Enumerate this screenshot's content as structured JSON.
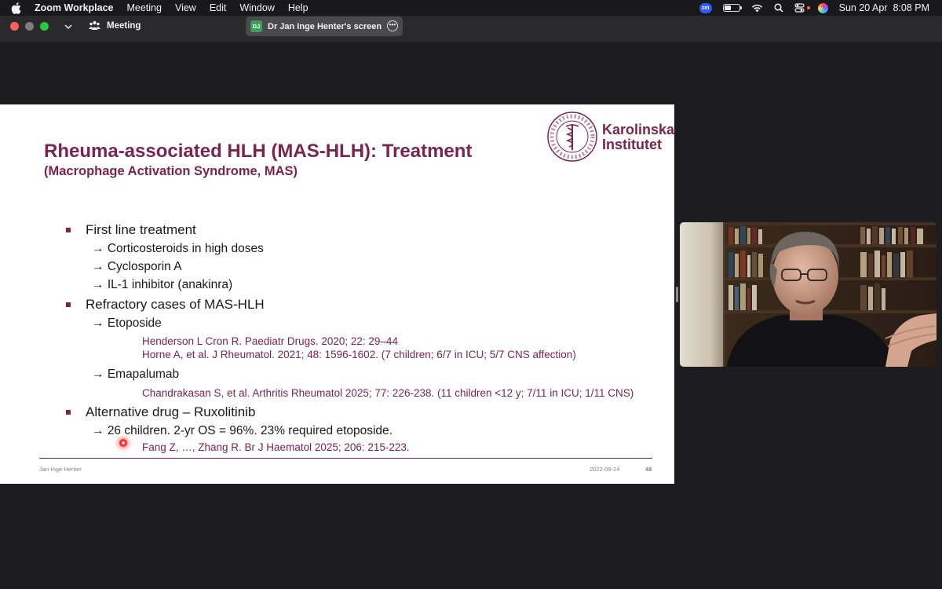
{
  "menubar": {
    "app_name": "Zoom Workplace",
    "menus": [
      "Meeting",
      "View",
      "Edit",
      "Window",
      "Help"
    ],
    "status_badge": "zm",
    "datetime": "Sun 20 Apr  8:08 PM"
  },
  "zoombar": {
    "meeting_label": "Meeting",
    "share_initials": "DJ",
    "share_label": "Dr Jan Inge Henter's screen"
  },
  "slide": {
    "title": "Rheuma-associated HLH (MAS-HLH): Treatment",
    "subtitle": "(Macrophage Activation Syndrome, MAS)",
    "logo_text_line1": "Karolinska",
    "logo_text_line2": "Institutet",
    "seal_text": "KAROLINSKA INSTITUTET · ANNO 1810",
    "sections": [
      {
        "heading": "First line treatment",
        "items": [
          "Corticosteroids in high doses",
          "Cyclosporin A",
          "IL-1 inhibitor (anakinra)"
        ]
      },
      {
        "heading": "Refractory cases of MAS-HLH",
        "items": [
          {
            "label": "Etoposide",
            "refs": [
              "Henderson L  Cron R. Paediatr Drugs. 2020; 22: 29–44",
              "Horne A, et al. J Rheumatol. 2021; 48: 1596-1602. (7 children; 6/7 in ICU; 5/7 CNS affection)"
            ]
          },
          {
            "label": "Emapalumab",
            "refs": [
              "Chandrakasan S, et al. Arthritis Rheumatol 2025; 77: 226-238. (11 children <12 y; 7/11 in ICU; 1/11 CNS)"
            ]
          }
        ]
      },
      {
        "heading": "Alternative drug – Ruxolitinib",
        "items": [
          {
            "label": "26 children. 2-yr OS = 96%. 23% required etoposide.",
            "refs": [
              "Fang Z, …, Zhang R. Br J Haematol 2025; 206: 215-223."
            ]
          }
        ]
      }
    ],
    "arrow": "→",
    "footer_author": "Jan-Inge Henter",
    "footer_date": "2022-09-24",
    "footer_page": "48"
  },
  "colors": {
    "accent": "#7a2450",
    "menubar_bg": "#19191b",
    "zoombar_bg": "#2a2a2c",
    "app_bg": "#1d1d1f"
  },
  "icons": [
    "apple-icon",
    "chevron-down-icon",
    "meeting-people-icon",
    "more-options-icon",
    "zoom-status-icon",
    "battery-icon",
    "wifi-icon",
    "search-icon",
    "control-center-icon",
    "siri-icon"
  ]
}
